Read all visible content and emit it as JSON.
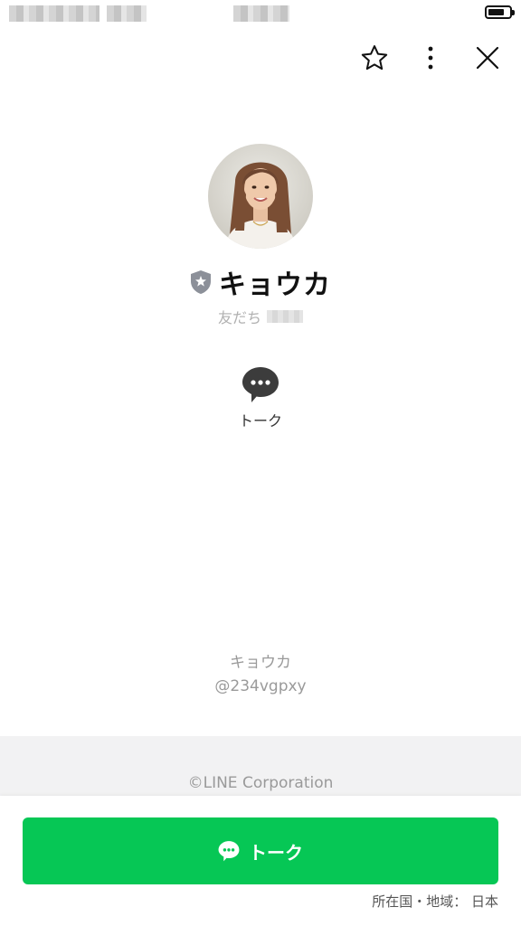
{
  "header": {
    "favorite_icon": "star-outline-icon",
    "more_icon": "vertical-dots-icon",
    "close_icon": "close-x-icon"
  },
  "status_bar": {
    "battery_level": 0.75
  },
  "profile": {
    "name": "キョウカ",
    "badge_icon": "shield-star-icon",
    "friend_label": "友だち",
    "avatar_icon": "profile-photo"
  },
  "actions": {
    "talk_label": "トーク",
    "talk_icon": "chat-bubble-icon"
  },
  "info": {
    "display_name": "キョウカ",
    "line_id": "@234vgpxy"
  },
  "footer": {
    "copyright": "©LINE Corporation"
  },
  "bottom": {
    "talk_button_label": "トーク",
    "region": "所在国・地域： 日本"
  },
  "colors": {
    "accent": "#06c755",
    "badge_gray": "#8c9099"
  }
}
